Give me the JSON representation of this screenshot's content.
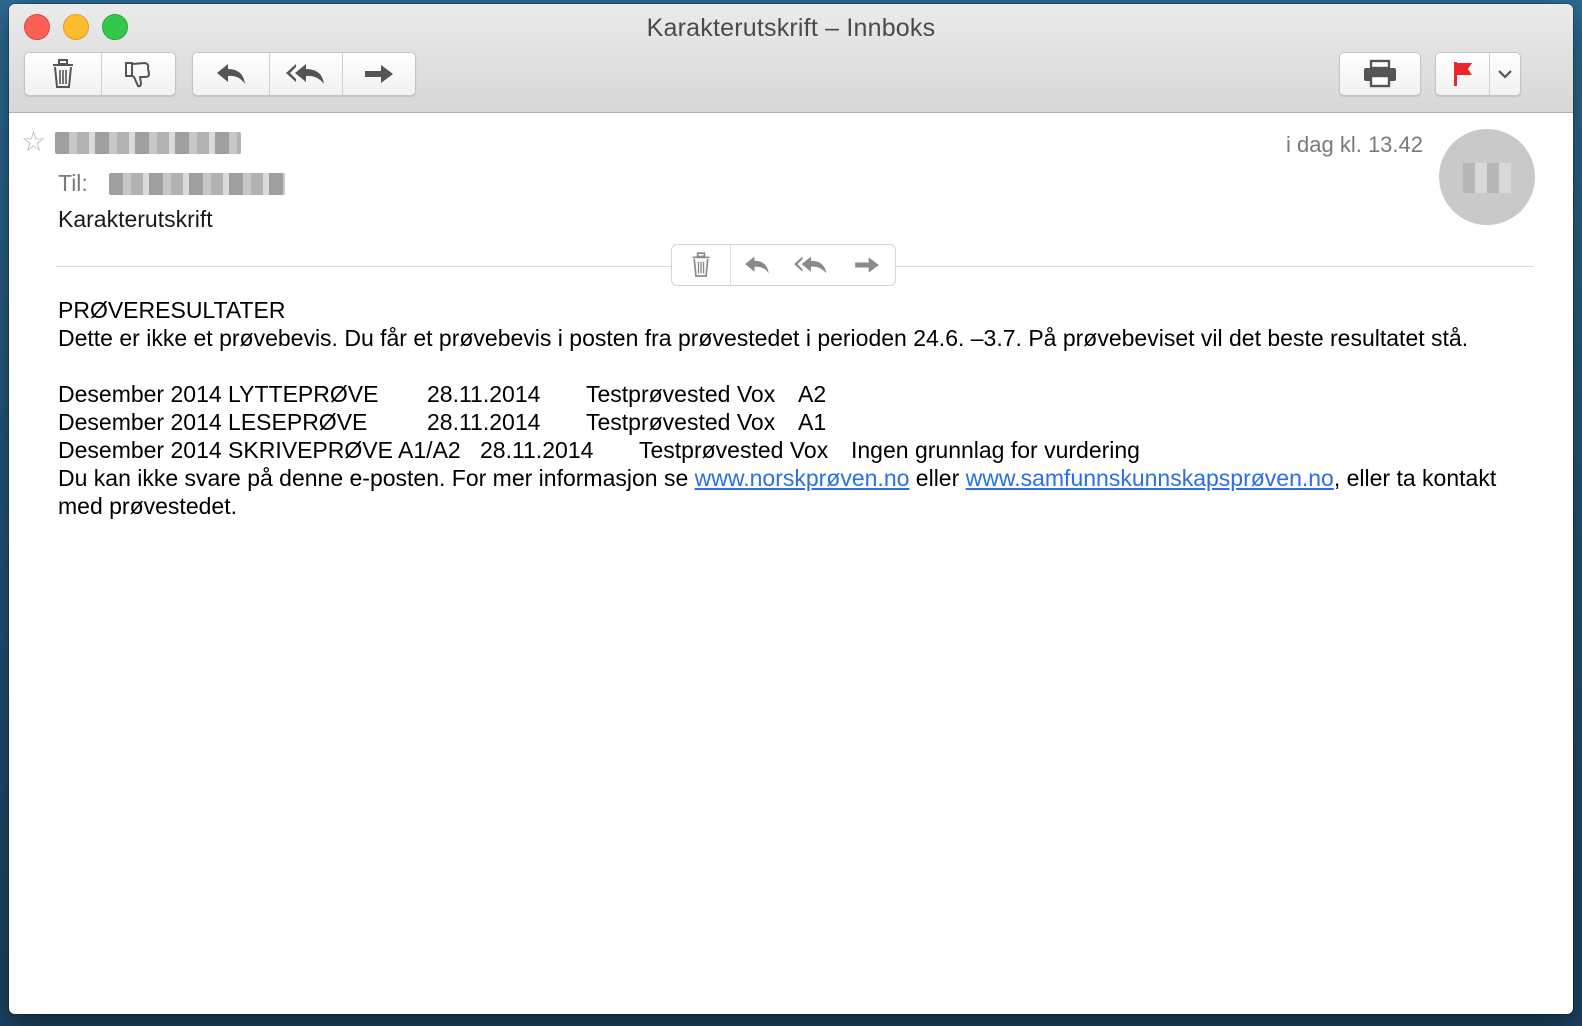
{
  "window": {
    "title": "Karakterutskrift – Innboks"
  },
  "toolbar": {
    "icons": [
      "trash-icon",
      "thumbs-down-icon",
      "reply-icon",
      "reply-all-icon",
      "forward-icon",
      "print-icon",
      "flag-icon",
      "chevron-down-icon"
    ],
    "flag_color": "#e8282b"
  },
  "message": {
    "to_label": "Til:",
    "subject": "Karakterutskrift",
    "date": "i dag kl. 13.42"
  },
  "body": {
    "heading": "PRØVERESULTATER",
    "intro": "Dette er ikke et prøvebevis. Du får et prøvebevis i posten fra prøvestedet i perioden 24.6. –3.7. På prøvebeviset vil det beste resultatet stå.",
    "results": [
      {
        "test": "Desember 2014 LYTTEPRØVE",
        "date": "28.11.2014",
        "place": "Testprøvested Vox",
        "result": "A2"
      },
      {
        "test": "Desember 2014 LESEPRØVE",
        "date": "28.11.2014",
        "place": "Testprøvested Vox",
        "result": "A1"
      },
      {
        "test": "Desember 2014 SKRIVEPRØVE A1/A2",
        "date": "28.11.2014",
        "place": "Testprøvested Vox",
        "result": "Ingen grunnlag for vurdering"
      }
    ],
    "footer": {
      "before": "Du kan ikke svare på denne e-posten. For mer informasjon se ",
      "link1": "www.norskprøven.no",
      "middle": " eller ",
      "link2": "www.samfunnskunnskapsprøven.no",
      "after": ", eller ta kontakt med prøvestedet."
    }
  },
  "colors": {
    "link": "#2a6ee8",
    "close": "#fc5f57",
    "minimize": "#fdbc2e",
    "zoom": "#34c84a"
  }
}
